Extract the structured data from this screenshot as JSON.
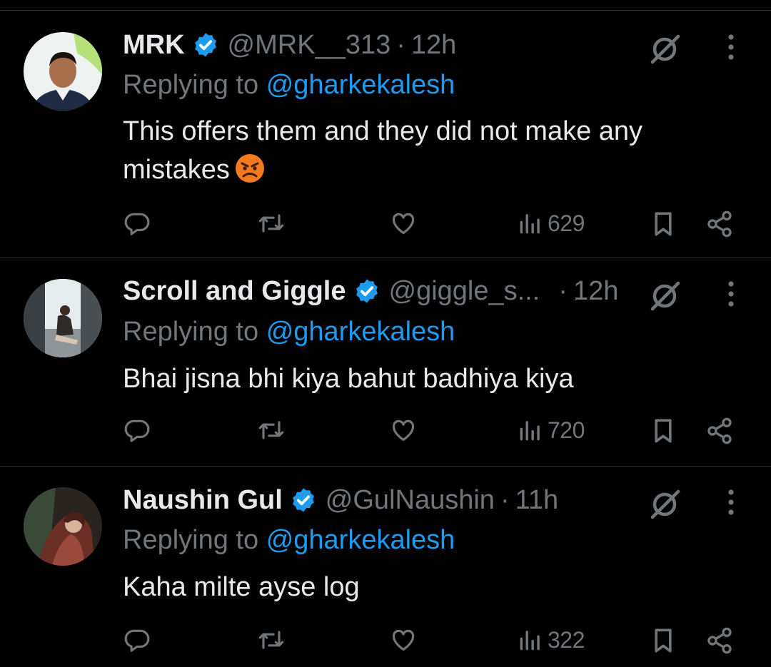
{
  "tweets": [
    {
      "name": "MRK",
      "handle": "@MRK__313",
      "dot": "·",
      "time": "12h",
      "reply_prefix": "Replying to",
      "reply_handle": "@gharkekalesh",
      "text": "This offers them and they did not make any mistakes",
      "views": "629",
      "emoji": "angry-face"
    },
    {
      "name": "Scroll and Giggle",
      "handle": "@giggle_s...",
      "dot": "·",
      "time": "12h",
      "reply_prefix": "Replying to",
      "reply_handle": "@gharkekalesh",
      "text": "Bhai jisna bhi kiya bahut badhiya kiya",
      "views": "720"
    },
    {
      "name": "Naushin Gul",
      "handle": "@GulNaushin",
      "dot": "·",
      "time": "11h",
      "reply_prefix": "Replying to",
      "reply_handle": "@gharkekalesh",
      "text": "Kaha milte ayse log",
      "views": "322"
    }
  ],
  "colors": {
    "background": "#000000",
    "text": "#e7e9ea",
    "muted": "#71767b",
    "link": "#1d9bf0",
    "divider": "#2f3336"
  },
  "icons": [
    "verified-badge-icon",
    "grok-icon",
    "more-icon",
    "reply-icon",
    "retweet-icon",
    "like-icon",
    "views-icon",
    "bookmark-icon",
    "share-icon"
  ]
}
